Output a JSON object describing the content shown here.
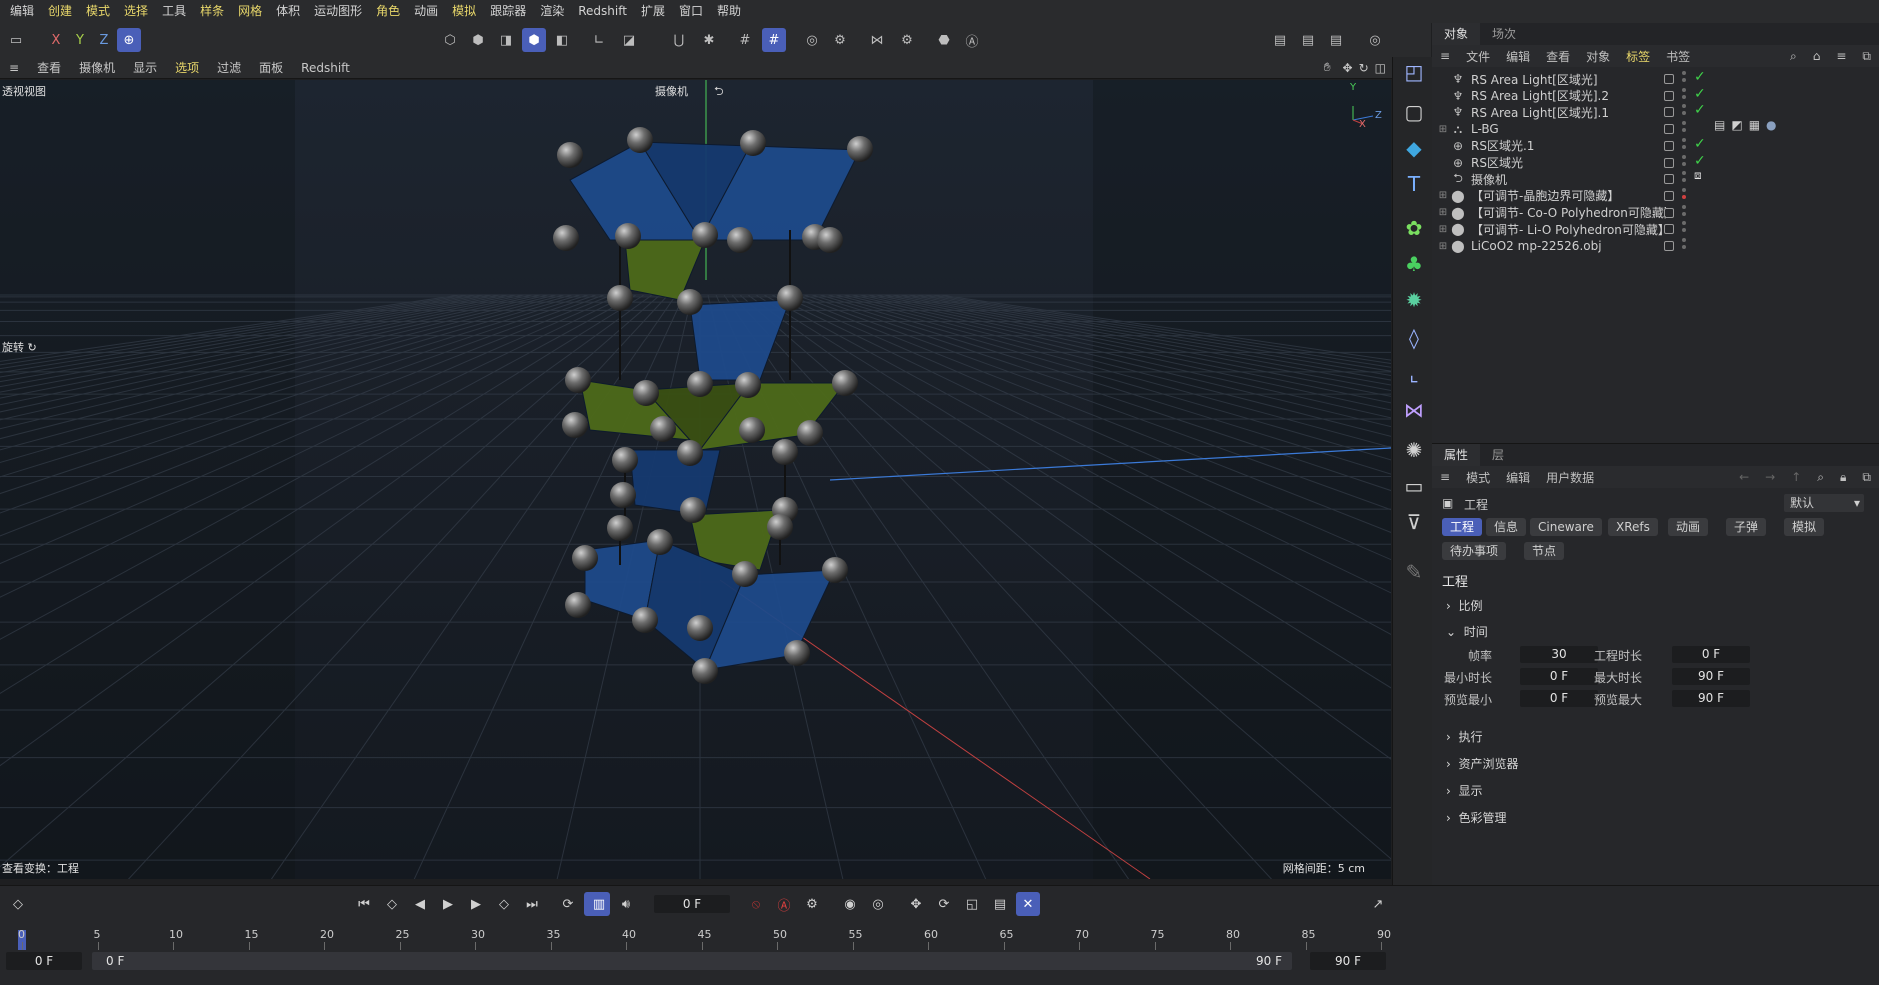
{
  "menu": [
    "编辑",
    "创建",
    "模式",
    "选择",
    "工具",
    "样条",
    "网格",
    "体积",
    "运动图形",
    "角色",
    "动画",
    "模拟",
    "跟踪器",
    "渲染",
    "Redshift",
    "扩展",
    "窗口",
    "帮助"
  ],
  "menu_highlight": [
    1,
    2,
    3,
    5,
    6,
    9,
    11
  ],
  "toolbar": {
    "axis_x": "X",
    "axis_y": "Y",
    "axis_z": "Z"
  },
  "viewport_menu": [
    "查看",
    "摄像机",
    "显示",
    "选项",
    "过滤",
    "面板",
    "Redshift"
  ],
  "viewport": {
    "view_name": "透视视图",
    "camera_label": "摄像机",
    "rotate_label": "旋转",
    "status_left": "查看变换：工程",
    "grid_spacing": "网格间距：5 cm",
    "gizmo_y": "Y",
    "gizmo_z": "Z",
    "gizmo_x": "X"
  },
  "object_manager": {
    "tabs": [
      "对象",
      "场次"
    ],
    "menu": [
      "文件",
      "编辑",
      "查看",
      "对象",
      "标签",
      "书签"
    ],
    "objects": [
      {
        "name": "RS Area Light[区域光]",
        "icon": "light-icon",
        "checked": true
      },
      {
        "name": "RS Area Light[区域光].2",
        "icon": "light-icon",
        "checked": true
      },
      {
        "name": "RS Area Light[区域光].1",
        "icon": "light-icon",
        "checked": true
      },
      {
        "name": "L-BG",
        "icon": "bg-icon",
        "checked": false
      },
      {
        "name": "RS区域光.1",
        "icon": "area-light-icon",
        "checked": true
      },
      {
        "name": "RS区域光",
        "icon": "area-light-icon",
        "checked": true
      },
      {
        "name": "摄像机",
        "icon": "camera-icon",
        "checked": false
      },
      {
        "name": "【可调节-晶胞边界可隐藏】",
        "icon": "null-icon",
        "checked": false
      },
      {
        "name": "【可调节- Co-O Polyhedron可隐藏】",
        "icon": "null-icon",
        "checked": false
      },
      {
        "name": "【可调节- Li-O Polyhedron可隐藏】",
        "icon": "null-icon",
        "checked": false
      },
      {
        "name": "LiCoO2 mp-22526.obj",
        "icon": "null-icon",
        "checked": false
      }
    ]
  },
  "attributes": {
    "tabs": [
      "属性",
      "层"
    ],
    "menu": [
      "模式",
      "编辑",
      "用户数据"
    ],
    "object_type": "工程",
    "preset": "默认",
    "pills": [
      "工程",
      "信息",
      "Cineware",
      "XRefs",
      "动画",
      "子弹",
      "模拟",
      "待办事项",
      "节点"
    ],
    "section_title": "工程",
    "sections": [
      "比例",
      "时间",
      "执行",
      "资产浏览器",
      "显示",
      "色彩管理"
    ],
    "time_fields": {
      "fps_label": "帧率",
      "fps": "30",
      "length_label": "工程时长",
      "length": "0 F",
      "min_label": "最小时长",
      "min": "0 F",
      "max_label": "最大时长",
      "max": "90 F",
      "pmin_label": "预览最小",
      "pmin": "0 F",
      "pmax_label": "预览最大",
      "pmax": "90 F"
    }
  },
  "timeline": {
    "current_frame": "0 F",
    "ticks": [
      "0",
      "5",
      "10",
      "15",
      "20",
      "25",
      "30",
      "35",
      "40",
      "45",
      "50",
      "55",
      "60",
      "65",
      "70",
      "75",
      "80",
      "85",
      "90"
    ],
    "range_start": "0 F",
    "range_start2": "0 F",
    "range_end": "90 F",
    "range_end2": "90 F"
  },
  "colors": {
    "accent": "#4a5fb8",
    "highlight": "#e8d76a",
    "check": "#3fd04a",
    "co_poly": "#1e4a8a",
    "li_poly": "#4d6a1a"
  }
}
